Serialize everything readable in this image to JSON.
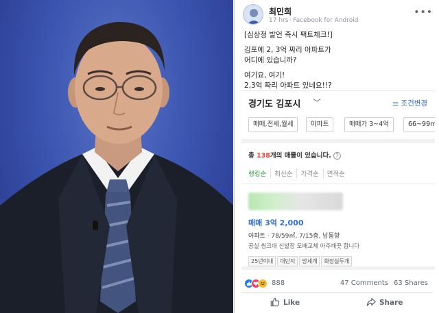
{
  "post": {
    "author": "최민희",
    "time": "17 hrs",
    "source": "Facebook for Android",
    "more_label": "•••",
    "text_lines": [
      "[심상정 발언 즉시 팩트체크!]",
      "김포에 2, 3억 짜리 아파트가",
      "어디에 있습니까?",
      "여기요, 여기!",
      "2,3억 짜리 아파트 있네요!!?"
    ]
  },
  "embed": {
    "region": "경기도 김포시",
    "chevron": "﹀",
    "filter_icon": "⚌",
    "filter_edit": "조건변경",
    "chips": [
      "매매,전세,월세",
      "아파트",
      "매매가 3~4억",
      "66~99m"
    ],
    "total_prefix": "총 ",
    "total_count": "138",
    "total_suffix": "개의 매물이 있습니다.",
    "help": "?",
    "sort_tabs": [
      "랭킹순",
      "최신순",
      "가격순",
      "면적순"
    ],
    "price": "매매 3억 2,000",
    "detail": "아파트 · 78/59㎡, 7/15층, 남동향",
    "desc": "공실 씽크대 신발장 도배교체 아주깨끗 합니다",
    "tags": [
      "25년이내",
      "대단지",
      "방세개",
      "화장실두개"
    ]
  },
  "stats": {
    "reaction_count": "888",
    "comments": "47 Comments",
    "shares": "63 Shares"
  },
  "actions": {
    "like": "Like",
    "share": "Share"
  },
  "colors": {
    "accent_blue": "#2f6fd6",
    "count_red": "#e2463c",
    "sort_green": "#2a9d3b",
    "fb_like": "#1877f2"
  }
}
